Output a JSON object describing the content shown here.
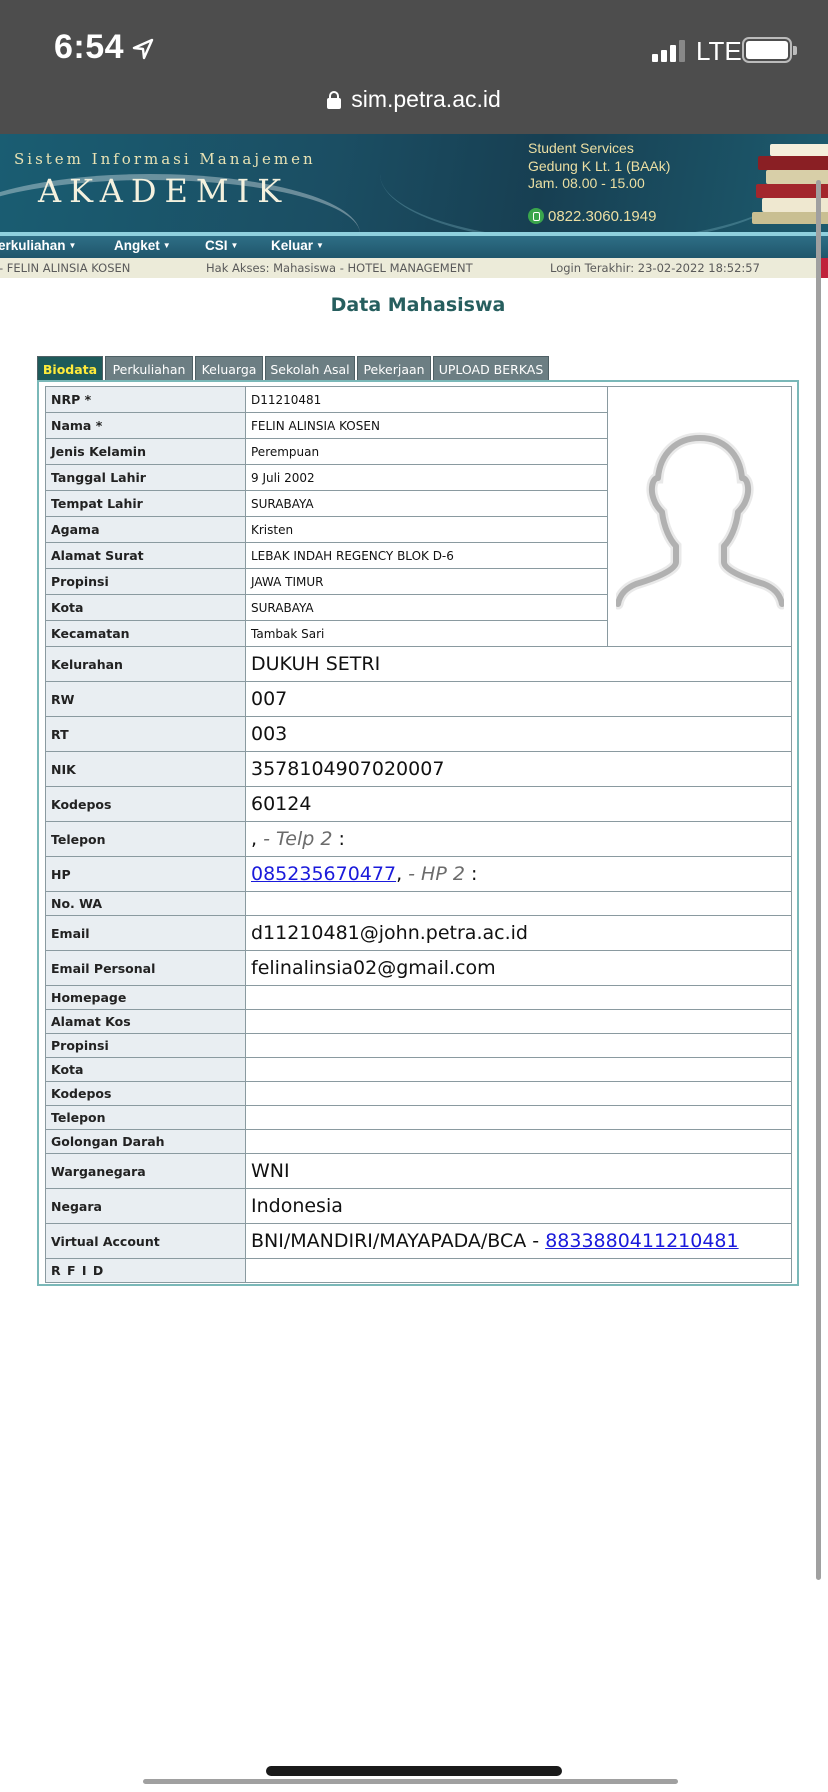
{
  "status_bar": {
    "time": "6:54",
    "network": "LTE"
  },
  "browser": {
    "url": "sim.petra.ac.id"
  },
  "banner": {
    "subtitle": "Sistem Informasi Manajemen",
    "title": "AKADEMIK",
    "info_lines": [
      "Student Services",
      "Gedung K Lt. 1 (BAAk)",
      "Jam. 08.00 - 15.00"
    ],
    "phone": "0822.3060.1949"
  },
  "nav": {
    "items": [
      "erkuliahan",
      "Angket",
      "CSI",
      "Keluar"
    ]
  },
  "infobar": {
    "user": "- FELIN ALINSIA KOSEN",
    "access": "Hak Akses: Mahasiswa - HOTEL MANAGEMENT",
    "last_login": "Login Terakhir: 23-02-2022 18:52:57"
  },
  "page": {
    "heading": "Data Mahasiswa"
  },
  "tabs": [
    "Biodata",
    "Perkuliahan",
    "Keluarga",
    "Sekolah Asal",
    "Pekerjaan",
    "UPLOAD BERKAS"
  ],
  "biodata": {
    "nrp": {
      "label": "NRP *",
      "value": "D11210481"
    },
    "nama": {
      "label": "Nama *",
      "value": "FELIN ALINSIA KOSEN"
    },
    "jenis_kelamin": {
      "label": "Jenis Kelamin",
      "value": "Perempuan"
    },
    "tanggal_lahir": {
      "label": "Tanggal Lahir",
      "value": "9 Juli 2002"
    },
    "tempat_lahir": {
      "label": "Tempat Lahir",
      "value": "SURABAYA"
    },
    "agama": {
      "label": "Agama",
      "value": "Kristen"
    },
    "alamat_surat": {
      "label": "Alamat Surat",
      "value": "LEBAK INDAH REGENCY BLOK D-6"
    },
    "propinsi": {
      "label": "Propinsi",
      "value": "JAWA TIMUR"
    },
    "kota": {
      "label": "Kota",
      "value": "SURABAYA"
    },
    "kecamatan": {
      "label": "Kecamatan",
      "value": "Tambak Sari"
    },
    "kelurahan": {
      "label": "Kelurahan",
      "value": "DUKUH SETRI"
    },
    "rw": {
      "label": "RW",
      "value": "007"
    },
    "rt": {
      "label": "RT",
      "value": "003"
    },
    "nik": {
      "label": "NIK",
      "value": "3578104907020007"
    },
    "kodepos": {
      "label": "Kodepos",
      "value": "60124"
    },
    "telepon": {
      "label": "Telepon",
      "prefix": ",",
      "telp2_label": "- Telp 2",
      "suffix": ":"
    },
    "hp": {
      "label": "HP",
      "value": "085235670477",
      "sep": ",",
      "hp2_label": "- HP 2",
      "suffix": ":"
    },
    "no_wa": {
      "label": "No. WA",
      "value": ""
    },
    "email": {
      "label": "Email",
      "value": "d11210481@john.petra.ac.id"
    },
    "email_personal": {
      "label": "Email Personal",
      "value": "felinalinsia02@gmail.com"
    },
    "homepage": {
      "label": "Homepage",
      "value": ""
    },
    "alamat_kos": {
      "label": "Alamat Kos",
      "value": ""
    },
    "propinsi_kos": {
      "label": "Propinsi",
      "value": ""
    },
    "kota_kos": {
      "label": "Kota",
      "value": ""
    },
    "kodepos_kos": {
      "label": "Kodepos",
      "value": ""
    },
    "telepon_kos": {
      "label": "Telepon",
      "value": ""
    },
    "golongan_darah": {
      "label": "Golongan Darah",
      "value": ""
    },
    "warganegara": {
      "label": "Warganegara",
      "value": "WNI"
    },
    "negara": {
      "label": "Negara",
      "value": "Indonesia"
    },
    "virtual_account": {
      "label": "Virtual Account",
      "banks": "BNI/MANDIRI/MAYAPADA/BCA -",
      "number": "8833880411210481"
    },
    "rfid": {
      "label": "R F I D",
      "value": ""
    }
  }
}
